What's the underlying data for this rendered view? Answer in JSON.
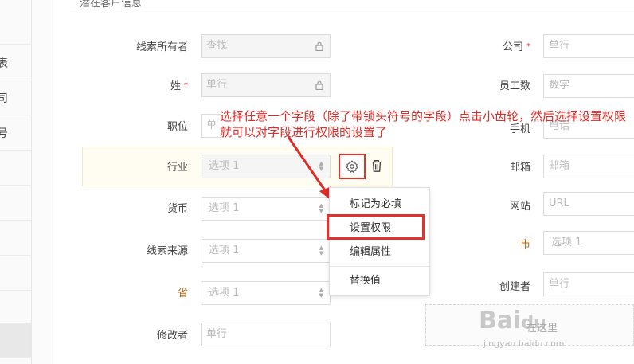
{
  "left_nav": [
    {
      "label": "表"
    },
    {
      "label": "司"
    },
    {
      "label": "号"
    }
  ],
  "section": {
    "title": "潜在客户信息"
  },
  "left_fields": [
    {
      "label": "线索所有者",
      "placeholder": "查找",
      "kind": "locked",
      "required": false
    },
    {
      "label": "姓",
      "placeholder": "单行",
      "kind": "locked",
      "required": true
    },
    {
      "label": "职位",
      "placeholder": "单",
      "kind": "text",
      "required": false
    },
    {
      "label": "行业",
      "placeholder": "选项 1",
      "kind": "select",
      "required": false
    },
    {
      "label": "货币",
      "placeholder": "选项 1",
      "kind": "select",
      "required": false
    },
    {
      "label": "线索来源",
      "placeholder": "选项 1",
      "kind": "select",
      "required": false
    },
    {
      "label": "省",
      "placeholder": "选项 1",
      "kind": "select",
      "required": false
    },
    {
      "label": "修改者",
      "placeholder": "单行",
      "kind": "text",
      "required": false
    }
  ],
  "right_fields": [
    {
      "label": "公司",
      "placeholder": "单行",
      "required": true
    },
    {
      "label": "员工数",
      "placeholder": "数字",
      "required": false
    },
    {
      "label": "手机",
      "placeholder": "电话",
      "required": false
    },
    {
      "label": "邮箱",
      "placeholder": "邮箱",
      "required": false
    },
    {
      "label": "网站",
      "placeholder": "URL",
      "required": false
    },
    {
      "label": "市",
      "placeholder": "选项 1",
      "required": false
    },
    {
      "label": "创建者",
      "placeholder": "单行",
      "required": false
    }
  ],
  "annotation": "选择任意一个字段（除了带锁头符号的字段）点击小齿轮，然后选择设置权限就可以对字段进行权限的设置了",
  "context_menu": [
    {
      "label": "标记为必填"
    },
    {
      "label": "设置权限"
    },
    {
      "label": "编辑属性"
    },
    {
      "label": "替换值"
    }
  ],
  "drop_zone": {
    "text": "在这里"
  },
  "watermark": {
    "logo": "Baidu经验",
    "url": "jingyan.baidu.com"
  },
  "colors": {
    "accent_red": "#e2322d",
    "required_star": "#e02b27",
    "highlight_row": "#fffcf2"
  }
}
